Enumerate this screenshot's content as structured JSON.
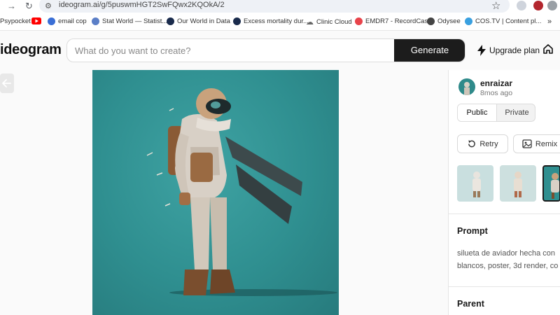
{
  "browser": {
    "url": "ideogram.ai/g/5puswmHGT2SwFQwx2KQOkA/2",
    "bookmarks": [
      {
        "label": "Psypocket",
        "color": "#e35d6a"
      },
      {
        "label": "",
        "color": "#ff0000",
        "icon": "youtube-icon"
      },
      {
        "label": "email cop",
        "color": "#3b6fd6"
      },
      {
        "label": "Stat World — Statist...",
        "color": "#5b7fc7"
      },
      {
        "label": "Our World in Data",
        "color": "#1a2b4c"
      },
      {
        "label": "Excess mortality dur...",
        "color": "#1a2b4c"
      },
      {
        "label": "Clinic Cloud",
        "color": "#888888"
      },
      {
        "label": "EMDR7 - RecordCast",
        "color": "#e8434a"
      },
      {
        "label": "Odysee",
        "color": "#444444"
      },
      {
        "label": "COS.TV | Content pl...",
        "color": "#3aa0e0"
      }
    ],
    "more_label": "»"
  },
  "header": {
    "logo_text": "ideogram",
    "search_placeholder": "What do you want to create?",
    "generate_label": "Generate",
    "upgrade_label": "Upgrade plan"
  },
  "panel": {
    "username": "enraizar",
    "time_ago": "8mos ago",
    "public_label": "Public",
    "private_label": "Private",
    "retry_label": "Retry",
    "remix_label": "Remix",
    "prompt_title": "Prompt",
    "prompt_line1": "silueta de aviador hecha con",
    "prompt_line2": "blancos, poster, 3d render, co",
    "parent_title": "Parent"
  },
  "colors": {
    "art_bg": "#2f8f90",
    "generate_bg": "#1c1c1c"
  }
}
